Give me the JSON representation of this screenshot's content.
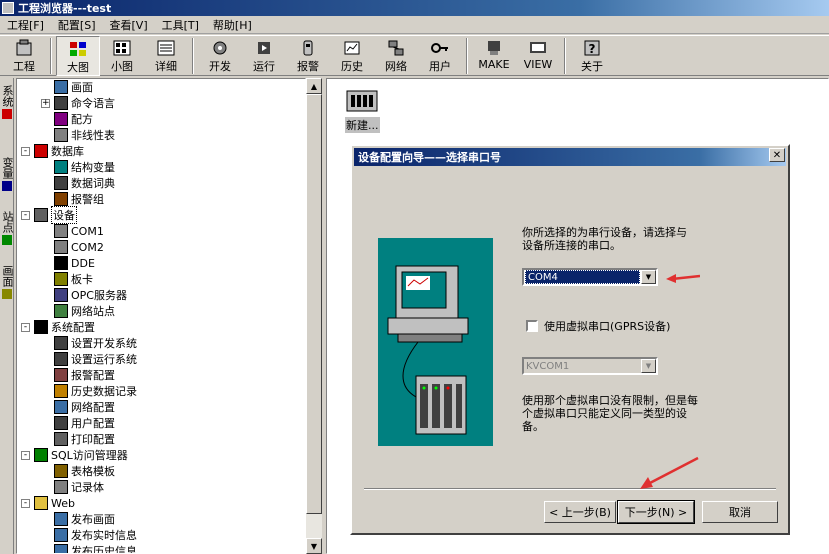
{
  "app": {
    "title": "工程浏览器---test"
  },
  "menu": [
    "工程[F]",
    "配置[S]",
    "查看[V]",
    "工具[T]",
    "帮助[H]"
  ],
  "toolbar": [
    {
      "label": "工程",
      "icon": "project-icon"
    },
    {
      "label": "大图",
      "icon": "large-icons-icon",
      "pressed": true
    },
    {
      "label": "小图",
      "icon": "small-icons-icon"
    },
    {
      "label": "详细",
      "icon": "details-icon"
    },
    {
      "label": "开发",
      "icon": "develop-icon"
    },
    {
      "label": "运行",
      "icon": "run-icon"
    },
    {
      "label": "报警",
      "icon": "alarm-icon"
    },
    {
      "label": "历史",
      "icon": "history-icon"
    },
    {
      "label": "网络",
      "icon": "network-icon"
    },
    {
      "label": "用户",
      "icon": "user-icon"
    },
    {
      "label": "MAKE",
      "icon": "make-icon"
    },
    {
      "label": "VIEW",
      "icon": "view-icon"
    },
    {
      "label": "关于",
      "icon": "about-icon"
    }
  ],
  "side_tabs": [
    "系统",
    "变量",
    "站点",
    "画面"
  ],
  "tree": [
    {
      "label": "画面",
      "level": 2,
      "icon": "screen-icon"
    },
    {
      "label": "命令语言",
      "level": 2,
      "icon": "command-icon",
      "expander": "+"
    },
    {
      "label": "配方",
      "level": 2,
      "icon": "recipe-icon"
    },
    {
      "label": "非线性表",
      "level": 2,
      "icon": "table-icon"
    },
    {
      "label": "数据库",
      "level": 1,
      "icon": "database-icon",
      "expander": "-"
    },
    {
      "label": "结构变量",
      "level": 2,
      "icon": "struct-icon"
    },
    {
      "label": "数据词典",
      "level": 2,
      "icon": "dictionary-icon"
    },
    {
      "label": "报警组",
      "level": 2,
      "icon": "alarm-group-icon"
    },
    {
      "label": "设备",
      "level": 1,
      "icon": "device-icon",
      "expander": "-",
      "selected": true
    },
    {
      "label": "COM1",
      "level": 2,
      "icon": "com-port-icon"
    },
    {
      "label": "COM2",
      "level": 2,
      "icon": "com-port-icon"
    },
    {
      "label": "DDE",
      "level": 2,
      "icon": "dde-icon"
    },
    {
      "label": "板卡",
      "level": 2,
      "icon": "card-icon"
    },
    {
      "label": "OPC服务器",
      "level": 2,
      "icon": "opc-icon"
    },
    {
      "label": "网络站点",
      "level": 2,
      "icon": "network-site-icon"
    },
    {
      "label": "系统配置",
      "level": 1,
      "icon": "tools-icon",
      "expander": "-"
    },
    {
      "label": "设置开发系统",
      "level": 2,
      "icon": "setting-icon"
    },
    {
      "label": "设置运行系统",
      "level": 2,
      "icon": "setting-icon"
    },
    {
      "label": "报警配置",
      "level": 2,
      "icon": "alarm-config-icon"
    },
    {
      "label": "历史数据记录",
      "level": 2,
      "icon": "history-record-icon"
    },
    {
      "label": "网络配置",
      "level": 2,
      "icon": "network-config-icon"
    },
    {
      "label": "用户配置",
      "level": 2,
      "icon": "user-config-icon"
    },
    {
      "label": "打印配置",
      "level": 2,
      "icon": "print-icon"
    },
    {
      "label": "SQL访问管理器",
      "level": 1,
      "icon": "sql-icon",
      "expander": "-"
    },
    {
      "label": "表格模板",
      "level": 2,
      "icon": "template-icon"
    },
    {
      "label": "记录体",
      "level": 2,
      "icon": "record-icon"
    },
    {
      "label": "Web",
      "level": 1,
      "icon": "folder-icon",
      "expander": "-"
    },
    {
      "label": "发布画面",
      "level": 2,
      "icon": "publish-icon"
    },
    {
      "label": "发布实时信息",
      "level": 2,
      "icon": "publish-icon"
    },
    {
      "label": "发布历史信息",
      "level": 2,
      "icon": "publish-icon"
    }
  ],
  "work_area": {
    "new_item_label": "新建..."
  },
  "dialog": {
    "title": "设备配置向导——选择串口号",
    "intro": [
      "你所选择的为串行设备，请选择与",
      "设备所连接的串口。"
    ],
    "com_value": "COM4",
    "virtual_checkbox_label": "使用虚拟串口(GPRS设备)",
    "virtual_value": "KVCOM1",
    "note": [
      "使用那个虚拟串口没有限制，但是每",
      "个虚拟串口只能定义同一类型的设",
      "备。"
    ],
    "buttons": {
      "prev": "< 上一步(B)",
      "next": "下一步(N) >",
      "cancel": "取消"
    }
  }
}
